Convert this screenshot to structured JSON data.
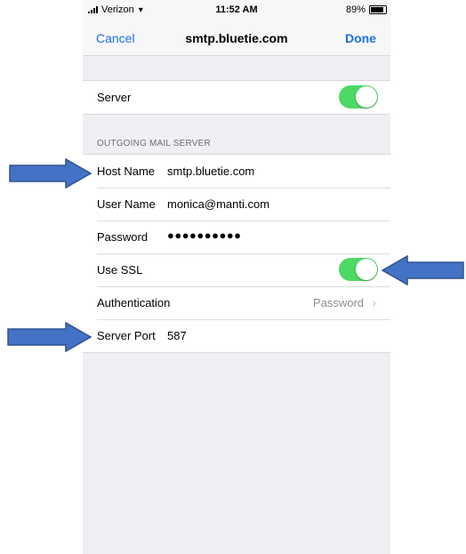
{
  "status_bar": {
    "carrier": "Verizon",
    "time": "11:52 AM",
    "battery": "89%",
    "battery_level": 0.89
  },
  "nav": {
    "cancel_label": "Cancel",
    "title": "smtp.bluetie.com",
    "done_label": "Done"
  },
  "server_row": {
    "label": "Server",
    "enabled": true
  },
  "section_header": "OUTGOING MAIL SERVER",
  "fields": {
    "host_name": {
      "label": "Host Name",
      "value": "smtp.bluetie.com"
    },
    "user_name": {
      "label": "User Name",
      "value": "monica@manti.com"
    },
    "password": {
      "label": "Password",
      "value": "●●●●●●●●●●"
    },
    "use_ssl": {
      "label": "Use SSL",
      "enabled": true
    },
    "authentication": {
      "label": "Authentication",
      "value": "Password"
    },
    "server_port": {
      "label": "Server Port",
      "value": "587"
    }
  },
  "colors": {
    "accent": "#1a6fe0",
    "toggle_on": "#4cd964",
    "arrow_fill": "#4472c4",
    "arrow_stroke": "#2f528f"
  },
  "icons": [
    "signal-icon",
    "wifi-icon",
    "battery-icon",
    "chevron-right-icon",
    "arrow-icon"
  ]
}
